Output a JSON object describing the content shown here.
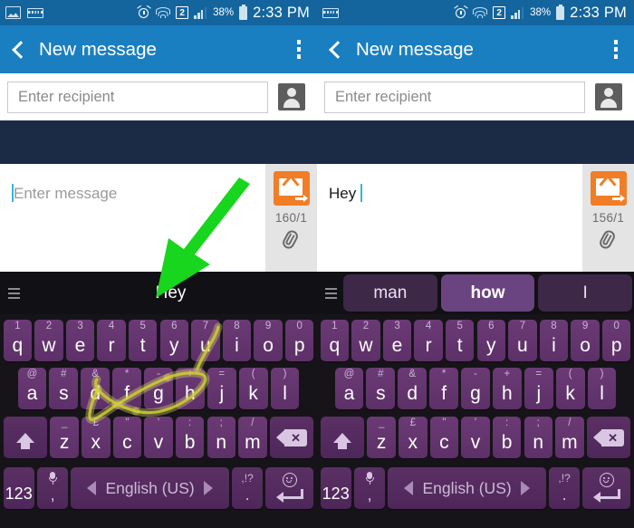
{
  "status_bar": {
    "icons_left": [
      "gallery-icon",
      "keyboard-icon"
    ],
    "icons_right": [
      "alarm-icon",
      "wifi-icon",
      "sim-badge",
      "signal-icon",
      "battery-icon"
    ],
    "sim_badge": "2",
    "battery_percent": "38%",
    "time": "2:33 PM"
  },
  "app_bar": {
    "back_icon": "back-chevron-icon",
    "title": "New message",
    "overflow_icon": "overflow-menu-icon"
  },
  "recipient": {
    "placeholder": "Enter recipient",
    "value": "",
    "contact_icon": "contact-picker-icon"
  },
  "panels": [
    {
      "id": "left",
      "message": {
        "placeholder": "Enter message",
        "value": ""
      },
      "char_count": "160/1",
      "send_icon": "send-message-icon",
      "attach_icon": "paperclip-icon",
      "suggestions": [
        {
          "label": "Hey",
          "style": "plain"
        }
      ],
      "swipe_trace": true
    },
    {
      "id": "right",
      "message": {
        "placeholder": "Enter message",
        "value": "Hey "
      },
      "char_count": "156/1",
      "send_icon": "send-message-icon",
      "attach_icon": "paperclip-icon",
      "suggestions": [
        {
          "label": "man",
          "style": "chip"
        },
        {
          "label": "how",
          "style": "chip-active"
        },
        {
          "label": "I",
          "style": "chip"
        }
      ],
      "swipe_trace": false
    }
  ],
  "keyboard": {
    "menu_icon": "suggestion-menu-icon",
    "row1": [
      {
        "alt": "1",
        "main": "q"
      },
      {
        "alt": "2",
        "main": "w"
      },
      {
        "alt": "3",
        "main": "e"
      },
      {
        "alt": "4",
        "main": "r"
      },
      {
        "alt": "5",
        "main": "t"
      },
      {
        "alt": "6",
        "main": "y"
      },
      {
        "alt": "7",
        "main": "u"
      },
      {
        "alt": "8",
        "main": "i"
      },
      {
        "alt": "9",
        "main": "o"
      },
      {
        "alt": "0",
        "main": "p"
      }
    ],
    "row2": [
      {
        "alt": "@",
        "main": "a"
      },
      {
        "alt": "#",
        "main": "s"
      },
      {
        "alt": "&",
        "main": "d"
      },
      {
        "alt": "*",
        "main": "f"
      },
      {
        "alt": "-",
        "main": "g"
      },
      {
        "alt": "+",
        "main": "h"
      },
      {
        "alt": "=",
        "main": "j"
      },
      {
        "alt": "(",
        "main": "k"
      },
      {
        "alt": ")",
        "main": "l"
      }
    ],
    "row3": [
      {
        "alt": "_",
        "main": "z"
      },
      {
        "alt": "£",
        "main": "x"
      },
      {
        "alt": "\"",
        "main": "c"
      },
      {
        "alt": "'",
        "main": "v"
      },
      {
        "alt": ":",
        "main": "b"
      },
      {
        "alt": ";",
        "main": "n"
      },
      {
        "alt": "/",
        "main": "m"
      }
    ],
    "shift_icon": "shift-key-icon",
    "backspace_icon": "backspace-key-icon",
    "row4": {
      "numeric_label": "123",
      "mic_icon": "microphone-icon",
      "comma": ",",
      "prev_lang_icon": "previous-language-arrow-icon",
      "space_label": "English (US)",
      "next_lang_icon": "next-language-arrow-icon",
      "punct_top": ",!?",
      "punct_bottom": ".",
      "emoji_icon": "emoji-icon",
      "enter_icon": "enter-key-icon"
    }
  },
  "annotation": {
    "arrow_color": "#18d51e",
    "arrow_target": "Hey",
    "trace_color": "#d4d425"
  },
  "colors": {
    "status_bar": "#14659e",
    "app_bar": "#1a7fc1",
    "dark_band": "#1c2b45",
    "send_button": "#f07e26",
    "key": "#66336f",
    "suggestion_active": "#6a4480"
  }
}
